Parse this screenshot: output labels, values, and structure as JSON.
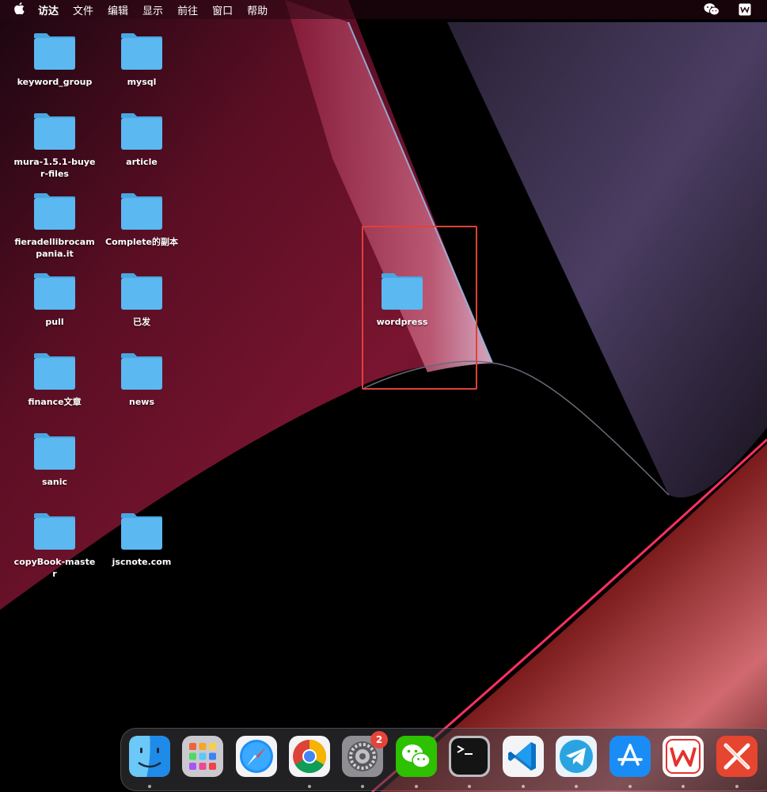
{
  "menubar": {
    "apple_icon": "apple-logo-icon",
    "items": [
      "访达",
      "文件",
      "编辑",
      "显示",
      "前往",
      "窗口",
      "帮助"
    ],
    "status_icons": [
      "wechat-icon",
      "wps-icon"
    ]
  },
  "desktop": {
    "items": [
      {
        "label": "keyword_group",
        "icon": "folder-icon"
      },
      {
        "label": "mysql",
        "icon": "folder-icon"
      },
      {
        "label": "mura-1.5.1-buyer-files",
        "icon": "folder-icon"
      },
      {
        "label": "article",
        "icon": "folder-icon"
      },
      {
        "label": "fieradellibrocampania.it",
        "icon": "folder-icon"
      },
      {
        "label": "Complete的副本",
        "icon": "folder-icon"
      },
      {
        "label": "pull",
        "icon": "folder-icon"
      },
      {
        "label": "已发",
        "icon": "folder-icon"
      },
      {
        "label": "finance文章",
        "icon": "folder-icon"
      },
      {
        "label": "news",
        "icon": "folder-icon"
      },
      {
        "label": "sanic",
        "icon": "folder-icon"
      },
      {
        "label": "copyBook-master",
        "icon": "folder-icon"
      },
      {
        "label": "jscnote.com",
        "icon": "folder-icon"
      },
      {
        "label": "wordpress",
        "icon": "folder-icon"
      }
    ],
    "highlight_color": "#e0403a",
    "folder_color": "#5bb8f0"
  },
  "dock": {
    "apps": [
      {
        "name": "finder",
        "icon": "finder-icon",
        "running": true
      },
      {
        "name": "launchpad",
        "icon": "launchpad-icon",
        "running": false
      },
      {
        "name": "safari",
        "icon": "safari-icon",
        "running": false
      },
      {
        "name": "chrome",
        "icon": "chrome-icon",
        "running": true
      },
      {
        "name": "system-preferences",
        "icon": "settings-gear-icon",
        "running": true,
        "badge": "2"
      },
      {
        "name": "wechat",
        "icon": "wechat-icon",
        "running": true
      },
      {
        "name": "terminal",
        "icon": "terminal-icon",
        "running": true
      },
      {
        "name": "vscode",
        "icon": "vscode-icon",
        "running": true
      },
      {
        "name": "telegram",
        "icon": "telegram-icon",
        "running": true
      },
      {
        "name": "app-store",
        "icon": "app-store-icon",
        "running": true
      },
      {
        "name": "wps-office",
        "icon": "wps-icon",
        "running": true
      },
      {
        "name": "xmind",
        "icon": "xmind-icon",
        "running": true
      }
    ]
  }
}
